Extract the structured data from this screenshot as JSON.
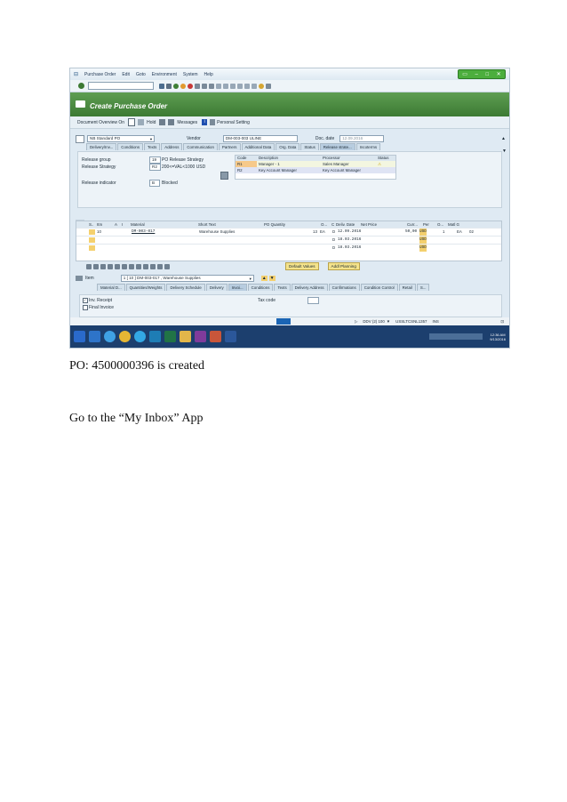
{
  "menu": [
    "Purchase Order",
    "Edit",
    "Goto",
    "Environment",
    "System",
    "Help"
  ],
  "window_controls": [
    "▭",
    "–",
    "□",
    "✕"
  ],
  "title": "Create Purchase Order",
  "app_toolbar": [
    "Document Overview On",
    "Hold",
    "Messages",
    "Personal Setting"
  ],
  "header": {
    "doc_type": "NB Standard PO",
    "vendor_label": "Vendor",
    "vendor": "DM-003-003 ULINE",
    "doc_date_label": "Doc. date",
    "doc_date": "12.09.2016"
  },
  "header_tabs": [
    "Delivery/Inv...",
    "Conditions",
    "Texts",
    "Address",
    "Communication",
    "Partners",
    "Additional Data",
    "Org. Data",
    "Status",
    "Release strate...",
    "Incoterms"
  ],
  "release": {
    "group_label": "Release group",
    "group_code": "19",
    "group_value": "PO Release Strategy",
    "strategy_label": "Release Strategy",
    "strategy_code": "R2",
    "strategy_value": "200<=VAL<1000 USD",
    "indicator_label": "Release indicator",
    "indicator_code": "B",
    "indicator_value": "Blocked",
    "table_headers": [
      "Code",
      "Description",
      "Processor",
      "Status"
    ],
    "rows": [
      {
        "code": "R1",
        "desc": "Manager - 1",
        "proc": "Sales Manager",
        "status": "⚠"
      },
      {
        "code": "R2",
        "desc": "Key Account Manager",
        "proc": "Key Account Manager",
        "status": ""
      }
    ]
  },
  "items": {
    "headers": [
      "S..",
      "Itm",
      "A",
      "I",
      "Material",
      "Short Text",
      "PO Quantity",
      "O...",
      "C",
      "Deliv. Date",
      "Net Price",
      "Curr...",
      "Per",
      "O...",
      "Matl G"
    ],
    "row1": {
      "itm": "10",
      "material": "DM-003-017",
      "short": "Warehouse Supplies",
      "qty": "13",
      "ou": "EA",
      "c": "D",
      "date": "12.09.2016",
      "price": "50,00",
      "curr": "USD",
      "per": "1",
      "o": "EA",
      "mg": "02"
    },
    "row2": {
      "c": "D",
      "date": "18.03.2016",
      "curr": "USD"
    },
    "row3": {
      "c": "D",
      "date": "18.03.2016",
      "curr": "USD"
    }
  },
  "item_buttons": [
    "Default Values",
    "Addl Planning"
  ],
  "item_detail": {
    "label": "Item",
    "value": "1 [ 10 ] DM-003-017 , Warehouse Supplies"
  },
  "item_tabs": [
    "Material D...",
    "Quantities/Weights",
    "Delivery Schedule",
    "Delivery",
    "Invoi...",
    "Conditions",
    "Texts",
    "Delivery Address",
    "Confirmations",
    "Condition Control",
    "Retail",
    "S..."
  ],
  "invoice": {
    "inv_receipt": "Inv. Receipt",
    "final_invoice": "Final Invoice",
    "tax_label": "Tax code"
  },
  "status_bar": {
    "system": "DDV (2) 100",
    "server": "USSLTCSNL1357",
    "mode": "INS",
    "time": "12:36 AM",
    "date": "9/13/2016"
  },
  "captions": [
    "PO: 4500000396 is created",
    "Go to the “My Inbox” App"
  ],
  "colors": {
    "sap_green": "#4f8f45",
    "taskbar": "#1c3f6e",
    "panel": "#dfeaf3"
  }
}
